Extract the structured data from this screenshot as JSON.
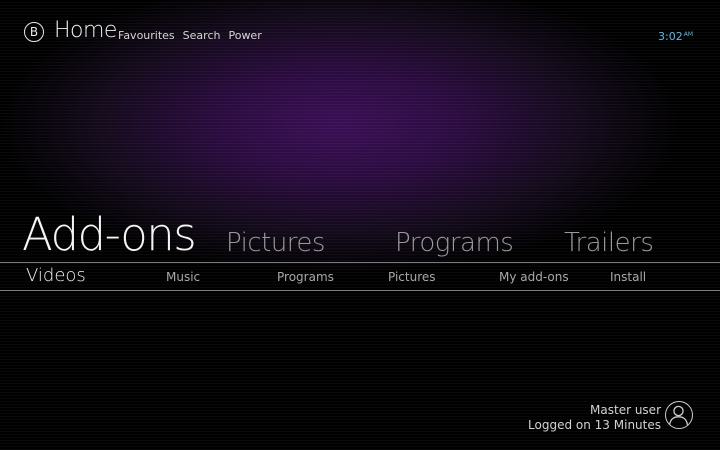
{
  "header": {
    "logo_letter": "B",
    "title": "Home",
    "nav": [
      "Favourites",
      "Search",
      "Power"
    ],
    "clock_time": "3:02",
    "clock_ampm": "AM",
    "clock_color": "#5ab8e6"
  },
  "categories": {
    "selected": "Add-ons",
    "others": [
      "Pictures",
      "Programs",
      "Trailers"
    ]
  },
  "submenu": {
    "active": "Videos",
    "items": [
      "Music",
      "Programs",
      "Pictures",
      "My add-ons",
      "Install"
    ]
  },
  "user": {
    "name": "Master user",
    "status": "Logged on 13 Minutes",
    "icon": "user-icon"
  },
  "colors": {
    "background": "#000000",
    "glow": "#3a0f55",
    "text": "#ffffff"
  }
}
